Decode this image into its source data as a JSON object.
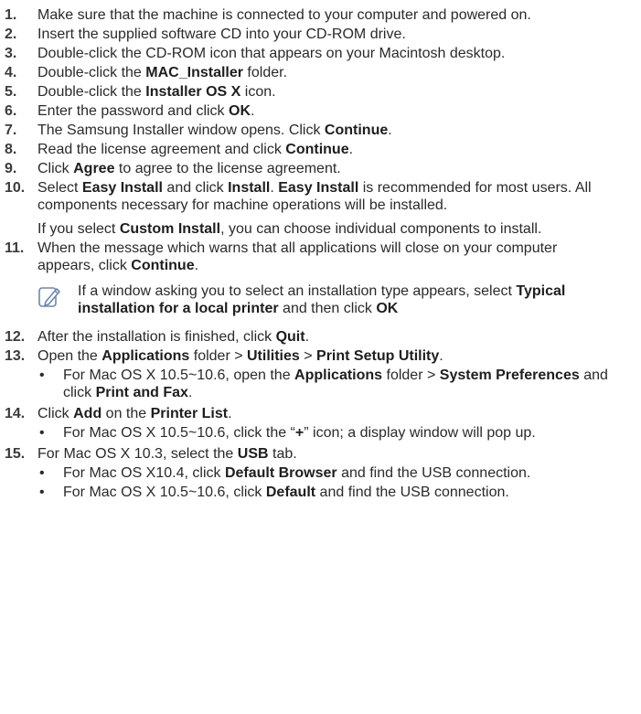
{
  "steps": [
    {
      "num": "1.",
      "segments": [
        {
          "t": "Make sure that the machine is connected to your computer and powered on."
        }
      ]
    },
    {
      "num": "2.",
      "segments": [
        {
          "t": "Insert the supplied software CD into your CD-ROM drive."
        }
      ]
    },
    {
      "num": "3.",
      "segments": [
        {
          "t": "Double-click the CD-ROM icon that appears on your Macintosh desktop."
        }
      ]
    },
    {
      "num": "4.",
      "segments": [
        {
          "t": "Double-click the "
        },
        {
          "t": "MAC_Installer",
          "b": true
        },
        {
          "t": " folder."
        }
      ]
    },
    {
      "num": "5.",
      "segments": [
        {
          "t": "Double-click the "
        },
        {
          "t": "Installer OS X",
          "b": true
        },
        {
          "t": " icon."
        }
      ]
    },
    {
      "num": "6.",
      "segments": [
        {
          "t": "Enter the password and click "
        },
        {
          "t": "OK",
          "b": true
        },
        {
          "t": "."
        }
      ]
    },
    {
      "num": "7.",
      "segments": [
        {
          "t": "The Samsung Installer window opens. Click "
        },
        {
          "t": "Continue",
          "b": true
        },
        {
          "t": "."
        }
      ]
    },
    {
      "num": "8.",
      "segments": [
        {
          "t": "Read the license agreement and click "
        },
        {
          "t": "Continue",
          "b": true
        },
        {
          "t": "."
        }
      ]
    },
    {
      "num": "9.",
      "segments": [
        {
          "t": "Click "
        },
        {
          "t": "Agree",
          "b": true
        },
        {
          "t": " to agree to the license agreement."
        }
      ]
    },
    {
      "num": "10.",
      "segments": [
        {
          "t": "Select "
        },
        {
          "t": "Easy Install",
          "b": true
        },
        {
          "t": " and click "
        },
        {
          "t": "Install",
          "b": true
        },
        {
          "t": ". "
        },
        {
          "t": "Easy Install",
          "b": true
        },
        {
          "t": " is recommended for most users. All components necessary for machine operations will be installed."
        }
      ],
      "para": [
        {
          "t": "If you select "
        },
        {
          "t": "Custom Install",
          "b": true
        },
        {
          "t": ", you can choose individual components to install."
        }
      ]
    },
    {
      "num": "11.",
      "segments": [
        {
          "t": "When the message which warns that all applications will close on your computer appears, click "
        },
        {
          "t": "Continue",
          "b": true
        },
        {
          "t": "."
        }
      ],
      "note": {
        "icon": "note-pencil-icon",
        "segments": [
          {
            "t": "If a window asking you to select an installation type appears, select "
          },
          {
            "t": "Typical installation for a local printer",
            "b": true
          },
          {
            "t": " and then click "
          },
          {
            "t": "OK",
            "b": true
          }
        ]
      }
    },
    {
      "num": "12.",
      "segments": [
        {
          "t": "After the installation is finished, click "
        },
        {
          "t": "Quit",
          "b": true
        },
        {
          "t": "."
        }
      ]
    },
    {
      "num": "13.",
      "segments": [
        {
          "t": "Open the "
        },
        {
          "t": "Applications",
          "b": true
        },
        {
          "t": " folder > "
        },
        {
          "t": "Utilities",
          "b": true
        },
        {
          "t": " > "
        },
        {
          "t": "Print Setup Utility",
          "b": true
        },
        {
          "t": "."
        }
      ],
      "bullets": [
        [
          {
            "t": "For Mac OS X 10.5~10.6, open the "
          },
          {
            "t": "Applications",
            "b": true
          },
          {
            "t": " folder > "
          },
          {
            "t": "System Preferences",
            "b": true
          },
          {
            "t": " and click "
          },
          {
            "t": "Print and Fax",
            "b": true
          },
          {
            "t": "."
          }
        ]
      ]
    },
    {
      "num": "14.",
      "segments": [
        {
          "t": "Click "
        },
        {
          "t": "Add",
          "b": true
        },
        {
          "t": " on the "
        },
        {
          "t": "Printer List",
          "b": true
        },
        {
          "t": "."
        }
      ],
      "bullets": [
        [
          {
            "t": "For Mac OS X 10.5~10.6, click the “"
          },
          {
            "t": "+",
            "b": true
          },
          {
            "t": "” icon; a display window will pop up."
          }
        ]
      ]
    },
    {
      "num": "15.",
      "segments": [
        {
          "t": "For Mac OS X 10.3, select the "
        },
        {
          "t": "USB",
          "b": true
        },
        {
          "t": " tab."
        }
      ],
      "bullets": [
        [
          {
            "t": "For Mac OS X10.4, click "
          },
          {
            "t": "Default Browser",
            "b": true
          },
          {
            "t": " and find the USB connection."
          }
        ],
        [
          {
            "t": "For Mac OS X 10.5~10.6, click "
          },
          {
            "t": "Default",
            "b": true
          },
          {
            "t": " and find the USB connection."
          }
        ]
      ]
    }
  ],
  "bullet_char": "•"
}
